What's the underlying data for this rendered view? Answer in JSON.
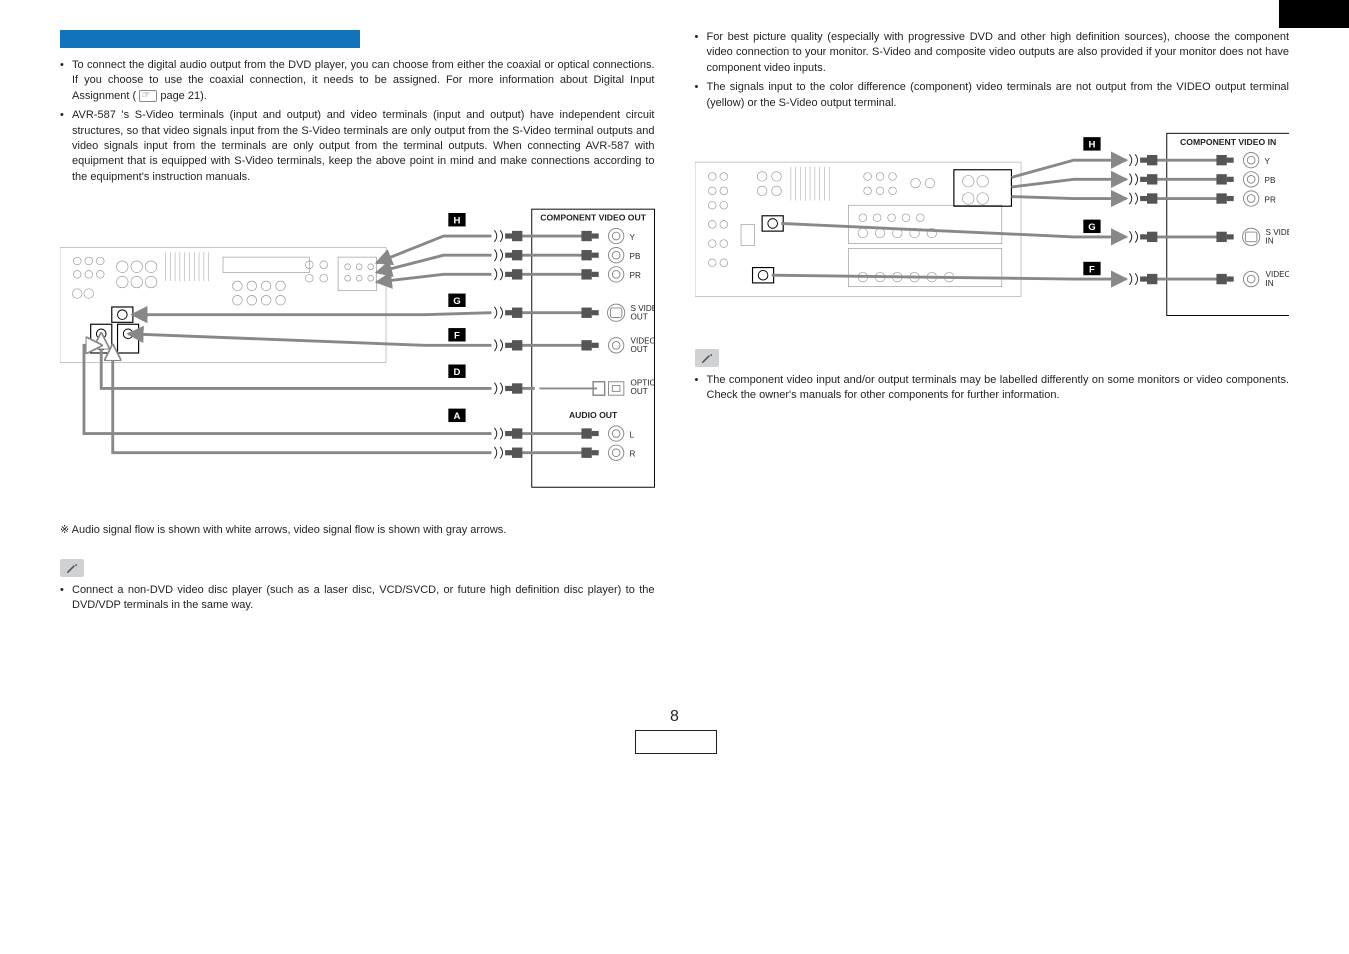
{
  "left": {
    "bullet1": "To connect the digital audio output from the DVD player, you can choose from either the coaxial or optical connections. If you choose to use the coaxial connection, it needs to be assigned. For more information about Digital Input Assignment (",
    "bullet1_pageref": "page 21).",
    "bullet2": "AVR-587 's S-Video terminals (input and output) and video terminals (input and output) have independent circuit structures, so that video signals input from the S-Video terminals are only output from the S-Video terminal outputs and video signals input from the terminals are only output from the terminal outputs. When connecting AVR-587 with equipment that is equipped with S-Video terminals, keep the above point in mind and make connections according to the equipment's instruction manuals.",
    "note_symbol": "※",
    "note_text": "Audio signal flow is shown with white arrows, video signal flow is shown with gray arrows.",
    "tip_bullet": "Connect a non-DVD video disc player (such as a laser disc, VCD/SVCD, or future high definition disc player) to the DVD/VDP terminals in the same way."
  },
  "right": {
    "bullet1": "For best picture quality (especially with progressive DVD and other high definition sources), choose the component video connection to your monitor. S-Video and composite video outputs are also provided if your monitor does not have component video inputs.",
    "bullet2": "The signals input to the color difference (component) video terminals are not output from the VIDEO output terminal (yellow) or the S-Video output terminal.",
    "tip_bullet": "The component video input and/or output terminals may be labelled differently on some monitors or video components. Check the owner's manuals for other components for further information."
  },
  "diagram_left": {
    "title": "COMPONENT VIDEO OUT",
    "y_label": "Y",
    "pb_label": "PB",
    "pr_label": "PR",
    "svideo_label": "S VIDEO\nOUT",
    "video_label": "VIDEO\nOUT",
    "optical_label": "OPTICAL\nOUT",
    "audio_label": "AUDIO OUT",
    "l_label": "L",
    "r_label": "R",
    "box_H": "H",
    "box_G": "G",
    "box_F": "F",
    "box_D": "D",
    "box_A": "A"
  },
  "diagram_right": {
    "title": "COMPONENT VIDEO IN",
    "y_label": "Y",
    "pb_label": "PB",
    "pr_label": "PR",
    "svideo_label": "S VIDEO\nIN",
    "video_label": "VIDEO\nIN",
    "box_H": "H",
    "box_G": "G",
    "box_F": "F"
  },
  "page_number": "8"
}
